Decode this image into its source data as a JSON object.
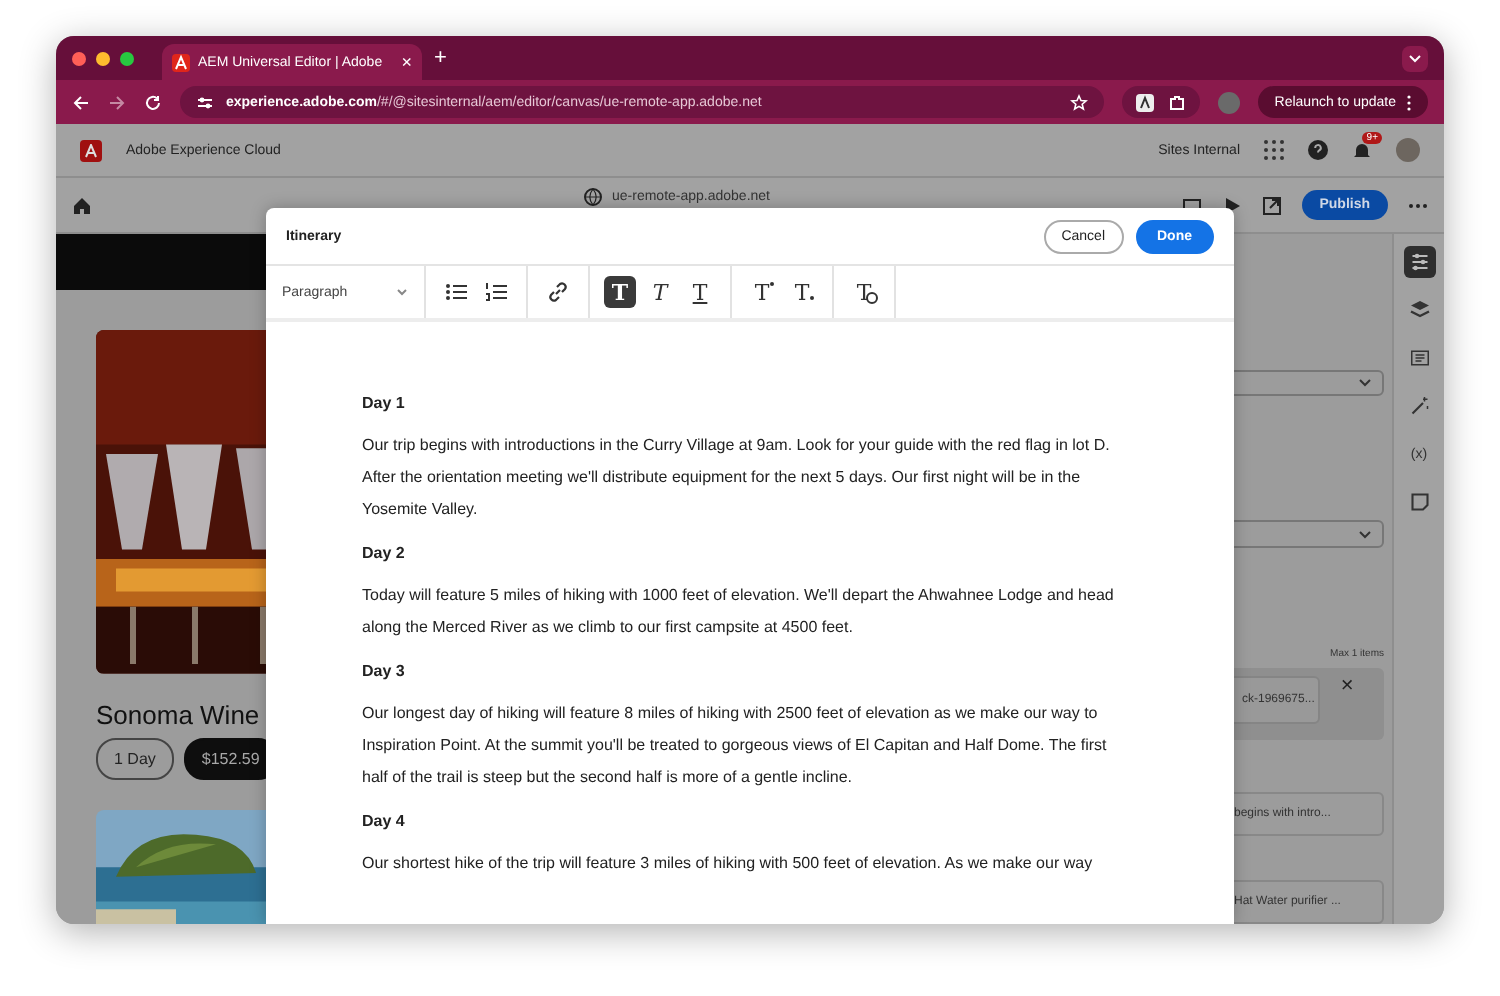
{
  "browser": {
    "tab_title": "AEM Universal Editor | Adobe",
    "tab_close": "×",
    "new_tab": "+",
    "url_host": "experience.adobe.com",
    "url_path": "/#/@sitesinternal/aem/editor/canvas/ue-remote-app.adobe.net",
    "relaunch": "Relaunch to update"
  },
  "app": {
    "product": "Adobe Experience Cloud",
    "org": "Sites Internal",
    "notification_count": "9+",
    "location": "ue-remote-app.adobe.net",
    "publish": "Publish"
  },
  "page": {
    "title": "Sonoma Wine",
    "chips": [
      {
        "label": "1 Day",
        "selected": false
      },
      {
        "label": "$152.59",
        "selected": true
      }
    ]
  },
  "panel": {
    "max_items": "Max 1 items",
    "asset": "ck-1969675...",
    "remove": "×",
    "items": [
      "begins with intro...",
      "Hat Water purifier ..."
    ]
  },
  "rail": [
    {
      "kind": "properties",
      "selected": true
    },
    {
      "kind": "layers",
      "selected": false
    },
    {
      "kind": "form",
      "selected": false
    },
    {
      "kind": "magic",
      "selected": false
    },
    {
      "kind": "variables",
      "label": "(x)",
      "selected": false
    },
    {
      "kind": "note",
      "selected": false
    }
  ],
  "dialog": {
    "title": "Itinerary",
    "cancel": "Cancel",
    "done": "Done",
    "format": "Paragraph",
    "tool_groups": [
      [
        {
          "kind": "bullet-list",
          "selected": false
        },
        {
          "kind": "numbered-list",
          "selected": false
        }
      ],
      [
        {
          "kind": "link",
          "selected": false
        }
      ],
      [
        {
          "kind": "bold",
          "label": "T",
          "selected": true
        },
        {
          "kind": "italic",
          "label": "T",
          "selected": false
        },
        {
          "kind": "underline",
          "label": "T",
          "selected": false
        }
      ],
      [
        {
          "kind": "superscript",
          "label": "T",
          "selected": false
        },
        {
          "kind": "subscript",
          "label": "T",
          "selected": false
        }
      ],
      [
        {
          "kind": "clear-format",
          "label": "T",
          "selected": false
        }
      ]
    ],
    "content": [
      {
        "kind": "heading",
        "text": "Day 1"
      },
      {
        "kind": "paragraph",
        "text": "Our trip begins with introductions in the Curry Village at 9am. Look for your guide with the red flag in lot D. After the orientation meeting we'll distribute equipment for the next 5 days. Our first night will be in the Yosemite Valley."
      },
      {
        "kind": "heading",
        "text": "Day 2"
      },
      {
        "kind": "paragraph",
        "text": "Today will feature 5 miles of hiking with 1000 feet of elevation. We'll depart the Ahwahnee Lodge and head along the Merced River as we climb to our first campsite at 4500 feet."
      },
      {
        "kind": "heading",
        "text": "Day 3"
      },
      {
        "kind": "paragraph",
        "text": "Our longest day of hiking will feature 8 miles of hiking with 2500 feet of elevation as we make our way to Inspiration Point. At the summit you'll be treated to gorgeous views of El Capitan and Half Dome. The first half of the trail is steep but the second half is more of a gentle incline."
      },
      {
        "kind": "heading",
        "text": "Day 4"
      },
      {
        "kind": "paragraph",
        "text": "Our shortest hike of the trip will feature 3 miles of hiking with 500 feet of elevation. As we make our way"
      }
    ]
  }
}
